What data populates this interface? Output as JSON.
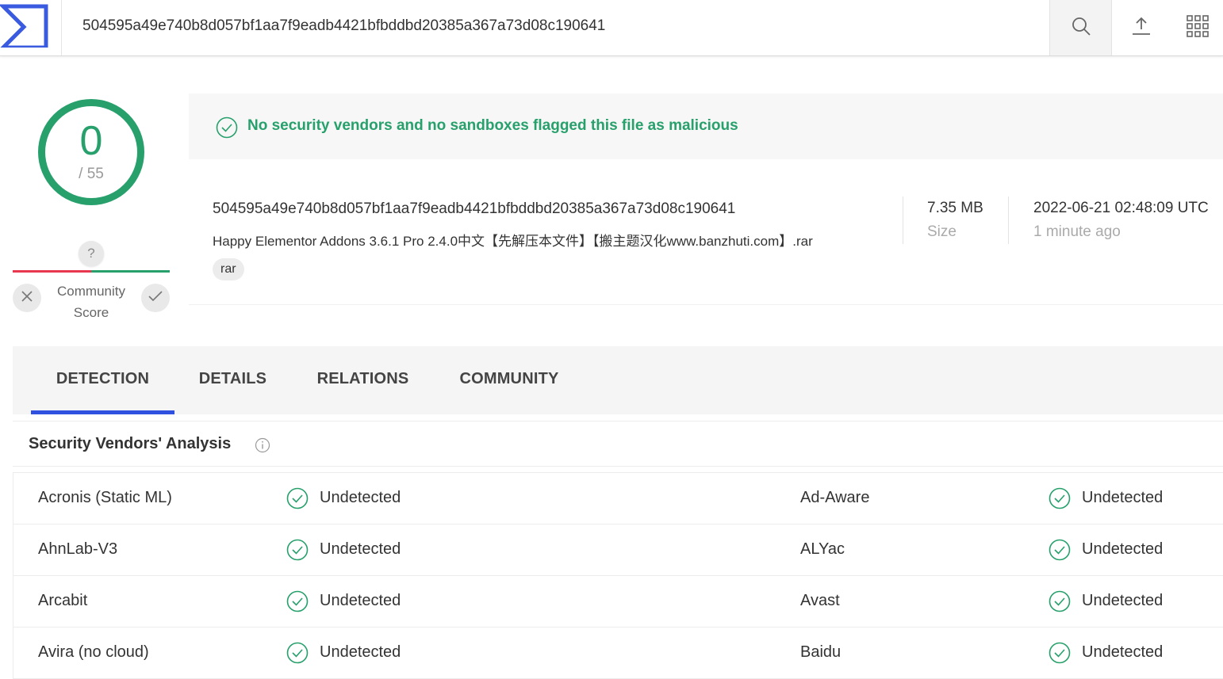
{
  "header": {
    "search_value": "504595a49e740b8d057bf1aa7f9eadb4421bfbddbd20385a367a73d08c190641",
    "icons": [
      "sigma-logo-icon",
      "search-icon",
      "upload-icon",
      "apps-grid-icon"
    ]
  },
  "score": {
    "detections": "0",
    "total": "/ 55",
    "community_question": "?",
    "community_label_1": "Community",
    "community_label_2": "Score",
    "colors": {
      "clean": "#27a06c",
      "malicious": "#e8384f"
    }
  },
  "banner": {
    "text": "No security vendors and no sandboxes flagged this file as malicious"
  },
  "file": {
    "hash": "504595a49e740b8d057bf1aa7f9eadb4421bfbddbd20385a367a73d08c190641",
    "name": "Happy Elementor Addons 3.6.1 Pro 2.4.0中文【先解压本文件】【搬主题汉化www.banzhuti.com】.rar",
    "tag": "rar",
    "size_value": "7.35 MB",
    "size_label": "Size",
    "date_value": "2022-06-21 02:48:09 UTC",
    "date_label": "1 minute ago"
  },
  "tabs": [
    {
      "label": "DETECTION"
    },
    {
      "label": "DETAILS"
    },
    {
      "label": "RELATIONS"
    },
    {
      "label": "COMMUNITY"
    }
  ],
  "vendors": {
    "title": "Security Vendors' Analysis",
    "rows": [
      {
        "left_name": "Acronis (Static ML)",
        "left_status": "Undetected",
        "right_name": "Ad-Aware",
        "right_status": "Undetected"
      },
      {
        "left_name": "AhnLab-V3",
        "left_status": "Undetected",
        "right_name": "ALYac",
        "right_status": "Undetected"
      },
      {
        "left_name": "Arcabit",
        "left_status": "Undetected",
        "right_name": "Avast",
        "right_status": "Undetected"
      },
      {
        "left_name": "Avira (no cloud)",
        "left_status": "Undetected",
        "right_name": "Baidu",
        "right_status": "Undetected"
      }
    ]
  }
}
